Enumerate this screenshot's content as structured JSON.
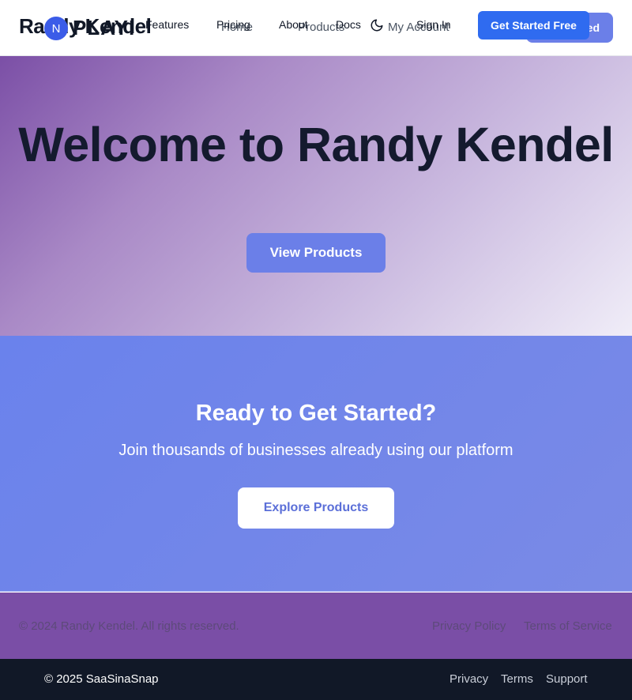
{
  "site_nav": {
    "brand": "Randy Kendel",
    "links": [
      "Home",
      "Products",
      "My Account"
    ],
    "cta_label": "Get Started"
  },
  "app_nav": {
    "logo_letter": "N",
    "brand": "PLAYI",
    "links": [
      "Features",
      "Pricing",
      "About",
      "Docs"
    ],
    "theme_icon": "moon-icon",
    "signin_label": "Sign In",
    "cta_label": "Get Started Free"
  },
  "hero": {
    "title": "Welcome to Randy Kendel",
    "button_label": "View Products"
  },
  "cta": {
    "title": "Ready to Get Started?",
    "subtitle": "Join thousands of businesses already using our platform",
    "button_label": "Explore Products"
  },
  "site_footer": {
    "copyright": "© 2024 Randy Kendel. All rights reserved.",
    "links": [
      "Privacy Policy",
      "Terms of Service"
    ]
  },
  "app_footer": {
    "copyright": "© 2025 SaaSinaSnap",
    "links": [
      "Privacy",
      "Terms",
      "Support"
    ]
  },
  "colors": {
    "primary": "#6b7fe8",
    "app_cta": "#2f6bf0",
    "purple": "#7a4ea6",
    "dark": "#111827"
  }
}
